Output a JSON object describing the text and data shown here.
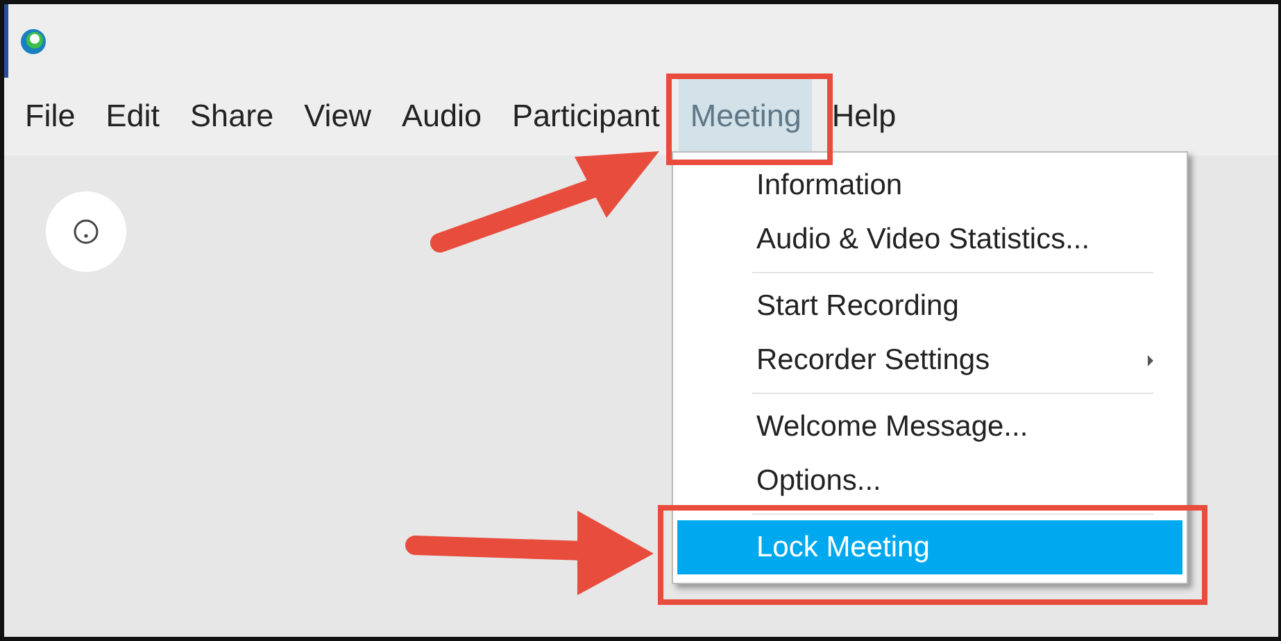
{
  "menu_bar": [
    {
      "label": "File",
      "selected": false
    },
    {
      "label": "Edit",
      "selected": false
    },
    {
      "label": "Share",
      "selected": false
    },
    {
      "label": "View",
      "selected": false
    },
    {
      "label": "Audio",
      "selected": false
    },
    {
      "label": "Participant",
      "selected": false
    },
    {
      "label": "Meeting",
      "selected": true
    },
    {
      "label": "Help",
      "selected": false
    }
  ],
  "dropdown": {
    "groups": [
      [
        {
          "label": "Information",
          "selected": false,
          "has_submenu": false
        },
        {
          "label": "Audio & Video Statistics...",
          "selected": false,
          "has_submenu": false
        }
      ],
      [
        {
          "label": "Start Recording",
          "selected": false,
          "has_submenu": false
        },
        {
          "label": "Recorder Settings",
          "selected": false,
          "has_submenu": true
        }
      ],
      [
        {
          "label": "Welcome Message...",
          "selected": false,
          "has_submenu": false
        },
        {
          "label": "Options...",
          "selected": false,
          "has_submenu": false
        }
      ],
      [
        {
          "label": "Lock Meeting",
          "selected": true,
          "has_submenu": false
        }
      ]
    ]
  }
}
